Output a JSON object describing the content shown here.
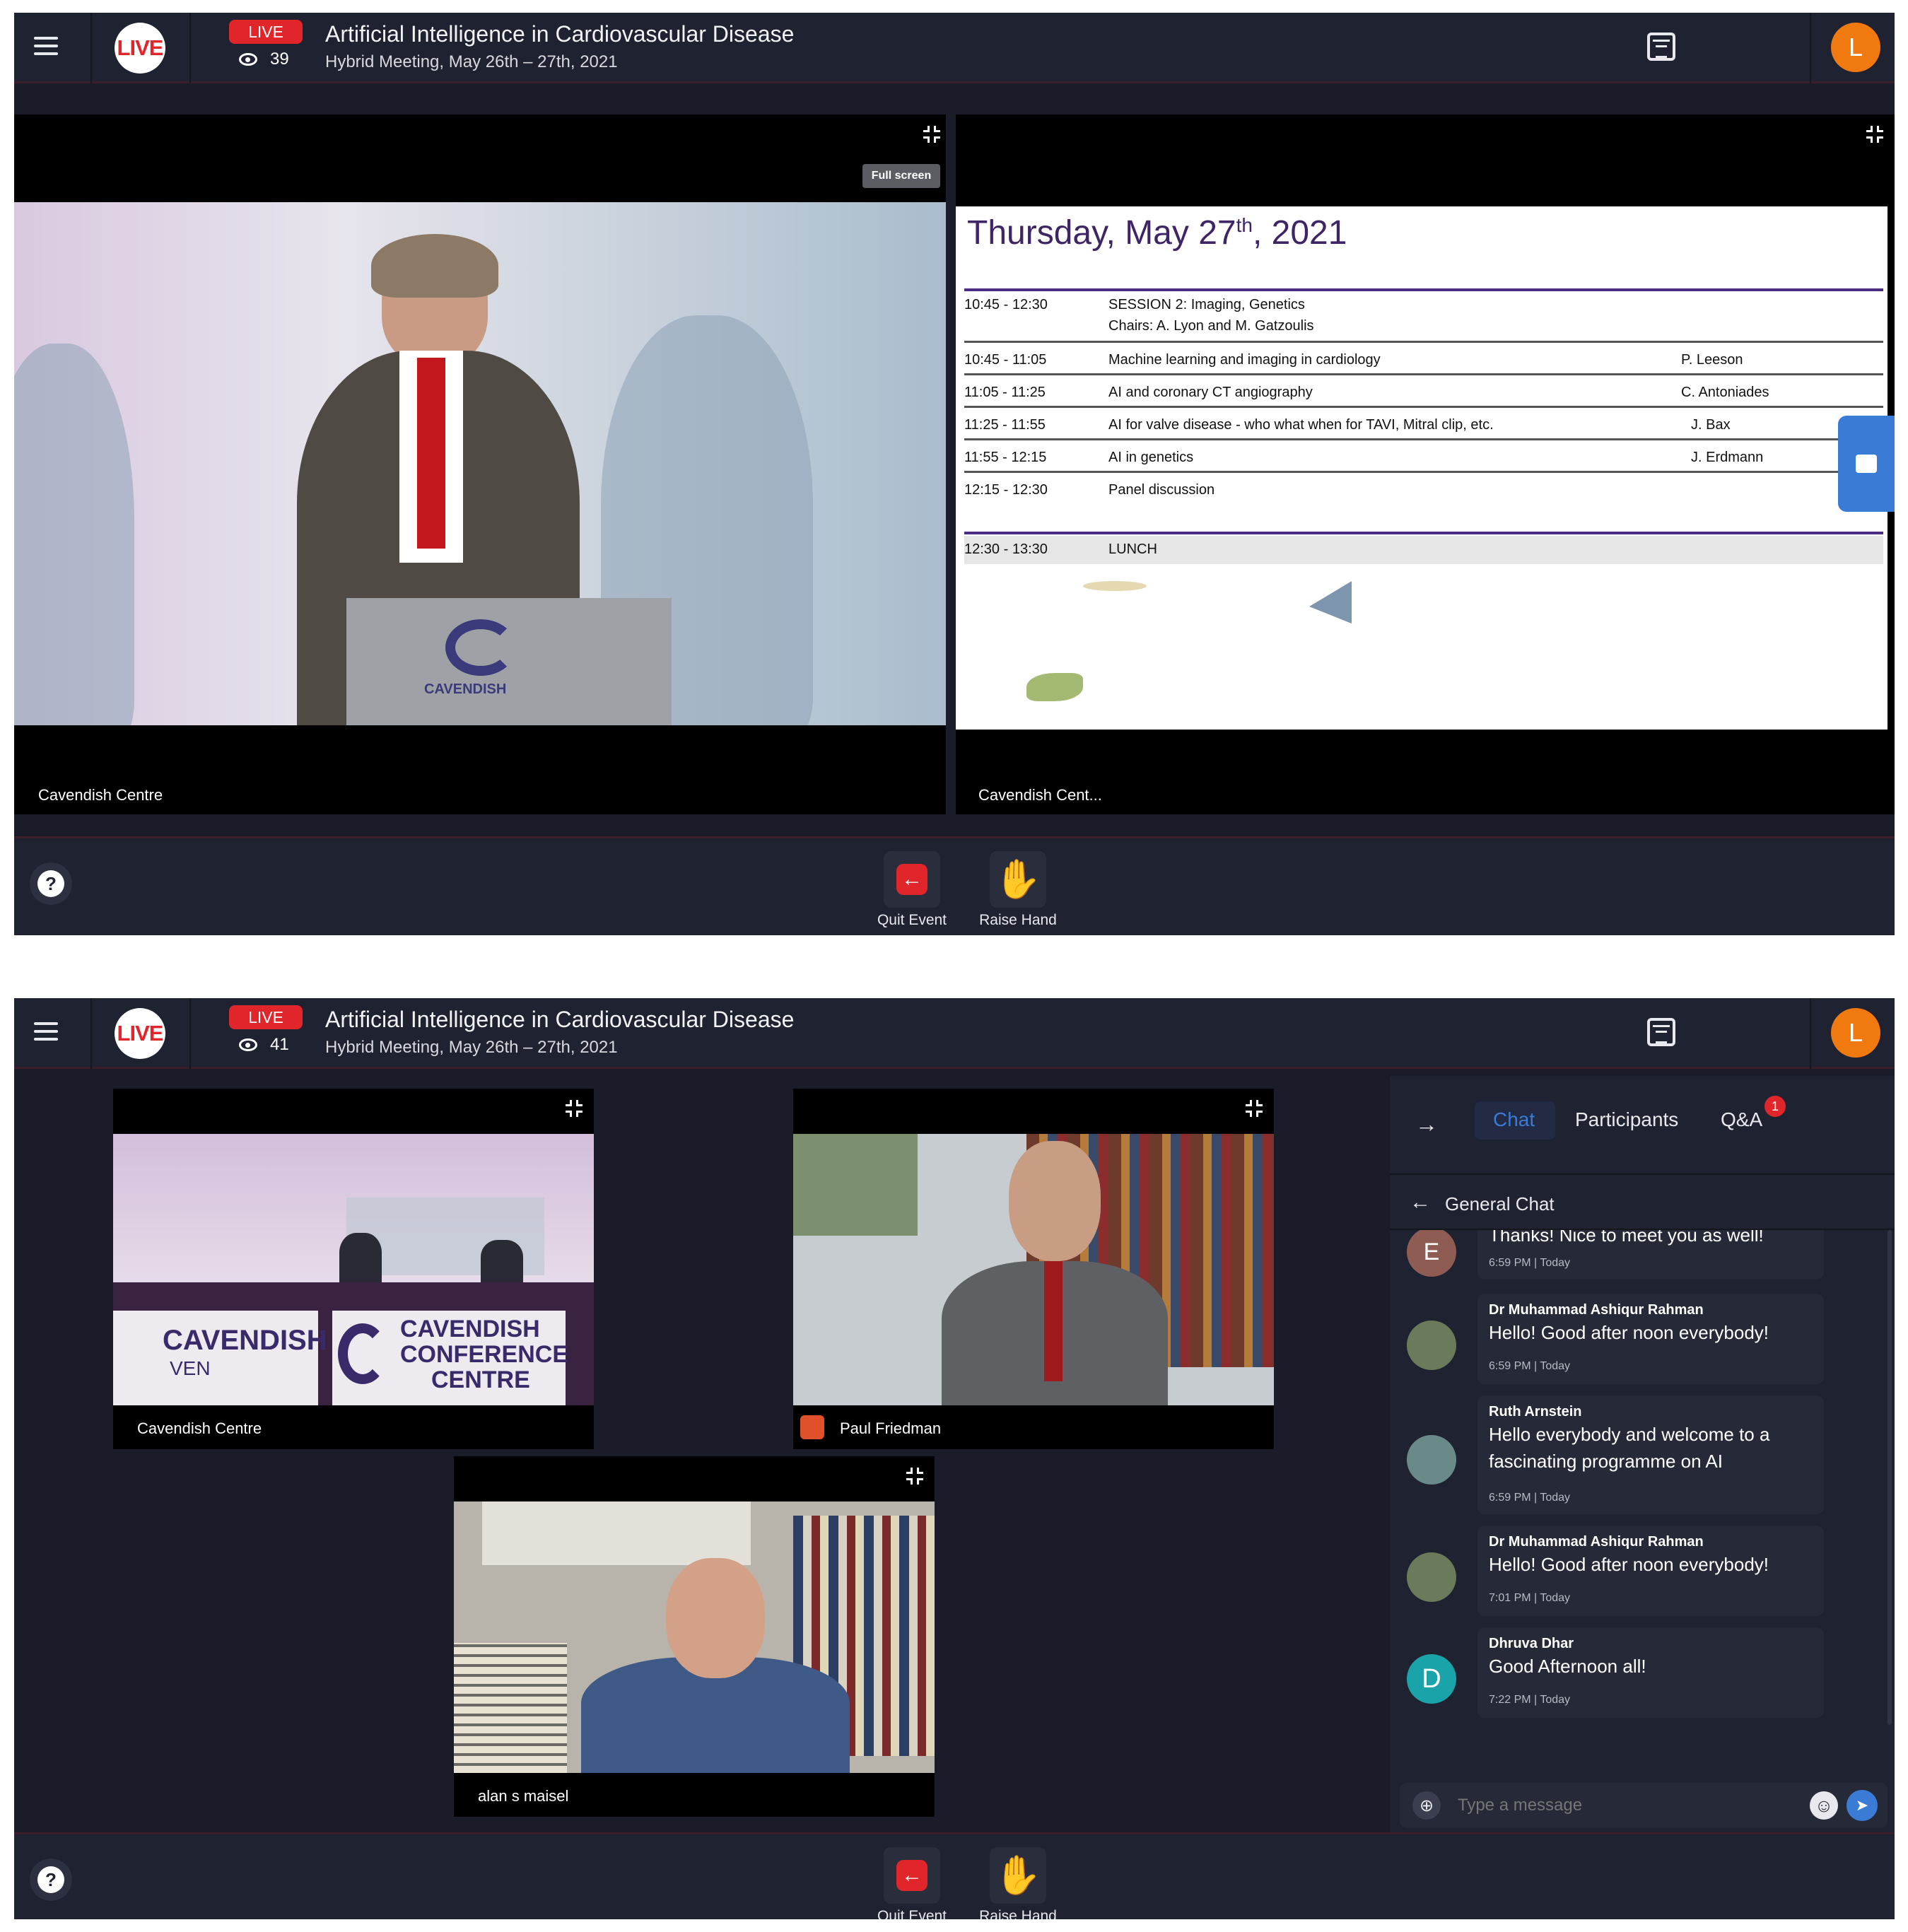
{
  "header": {
    "live_logo": "LIVE",
    "live_badge": "LIVE",
    "title": "Artificial Intelligence in Cardiovascular Disease",
    "subtitle": "Hybrid Meeting, May 26th – 27th, 2021",
    "user_initial": "L"
  },
  "screen1": {
    "viewer_count": "39",
    "fullscreen_label": "Full screen",
    "left_video_label": "Cavendish Centre",
    "right_video_label": "Cavendish Cent...",
    "podium_text": "CAVENDISH",
    "slide": {
      "title_main": "Thursday, May 27",
      "title_sup": "th",
      "title_end": ", 2021",
      "session_time": "10:45 - 12:30",
      "session_title": "SESSION 2: Imaging, Genetics",
      "session_chairs": "Chairs: A. Lyon and M. Gatzoulis",
      "rows": [
        {
          "time": "10:45 - 11:05",
          "topic": "Machine learning and imaging in cardiology",
          "speaker": "P. Leeson"
        },
        {
          "time": "11:05 - 11:25",
          "topic": "AI and coronary CT angiography",
          "speaker": "C. Antoniades"
        },
        {
          "time": "11:25 - 11:55",
          "topic": "AI for valve disease - who what when for TAVI, Mitral clip, etc.",
          "speaker": "J. Bax"
        },
        {
          "time": "11:55 - 12:15",
          "topic": "AI in genetics",
          "speaker": "J. Erdmann"
        },
        {
          "time": "12:15 - 12:30",
          "topic": "Panel discussion",
          "speaker": ""
        }
      ],
      "lunch_time": "12:30 - 13:30",
      "lunch_label": "LUNCH"
    }
  },
  "screen2": {
    "viewer_count": "41",
    "videos": {
      "v1_label": "Cavendish Centre",
      "v1_sign1": "CAVENDISH",
      "v1_sign1b": "VEN",
      "v1_sign2a": "CAVENDISH",
      "v1_sign2b": "CONFERENCE",
      "v1_sign2c": "CENTRE",
      "v2_label": "Paul Friedman",
      "v3_label": "alan s maisel"
    },
    "chat": {
      "tabs": [
        "Chat",
        "Participants",
        "Q&A"
      ],
      "qa_badge": "1",
      "channel": "General Chat",
      "messages": [
        {
          "initial": "E",
          "who": "",
          "text": "Thanks! Nice to meet you as well!",
          "time": "6:59 PM | Today"
        },
        {
          "initial": "",
          "who": "Dr Muhammad Ashiqur Rahman",
          "text": "Hello! Good after noon everybody!",
          "time": "6:59 PM | Today"
        },
        {
          "initial": "",
          "who": "Ruth Arnstein",
          "text": "Hello everybody and welcome to a fascinating programme on AI",
          "time": "6:59 PM | Today"
        },
        {
          "initial": "",
          "who": "Dr Muhammad Ashiqur Rahman",
          "text": "Hello! Good after noon everybody!",
          "time": "7:01 PM | Today"
        },
        {
          "initial": "D",
          "who": "Dhruva Dhar",
          "text": "Good Afternoon all!",
          "time": "7:22 PM | Today"
        }
      ],
      "input_placeholder": "Type a message"
    }
  },
  "actions": {
    "quit_label": "Quit Event",
    "raise_label": "Raise Hand"
  },
  "colors": {
    "live_red": "#e0262a",
    "accent_blue": "#3a7bd5",
    "avatar_orange": "#f07a10",
    "slide_purple": "#4b2d82",
    "background": "#1a1d29"
  },
  "icons": [
    "menu-icon",
    "eye-icon",
    "calendar-icon",
    "expand-icon",
    "help-icon",
    "quit-icon",
    "raise-hand-icon",
    "chat-bubble-icon",
    "arrow-right-icon",
    "arrow-left-icon",
    "attach-icon",
    "emoji-icon",
    "send-icon"
  ]
}
